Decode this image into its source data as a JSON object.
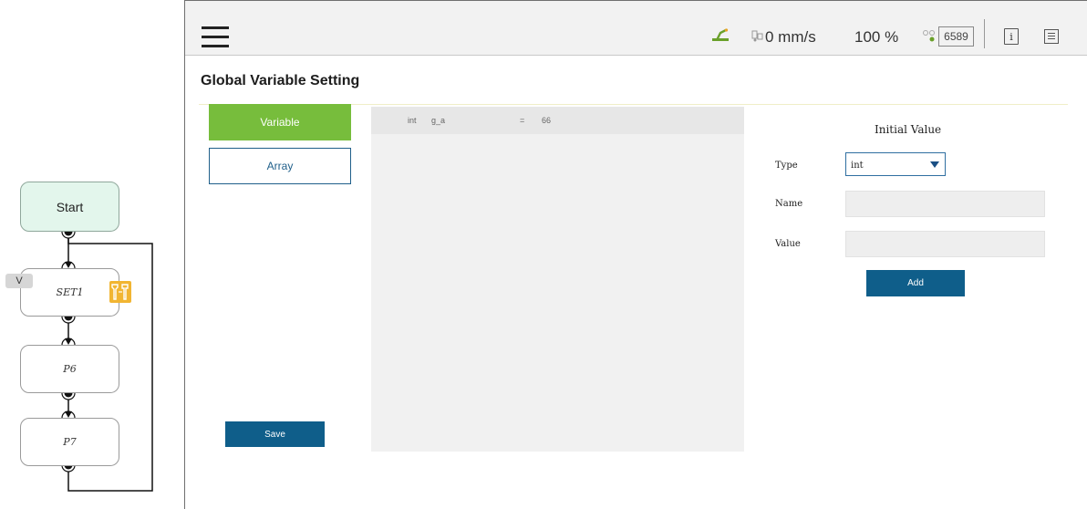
{
  "flow": {
    "nodes": [
      {
        "label": "Start"
      },
      {
        "label": "SET1"
      },
      {
        "label": "P6"
      },
      {
        "label": "P7"
      }
    ],
    "v_badge": "V"
  },
  "topbar": {
    "speed": "0 mm/s",
    "percent": "100 %",
    "counter": "6589",
    "icons": [
      "menu-icon",
      "robot-arm-icon",
      "speed-icon",
      "network-icon",
      "info-icon",
      "log-icon"
    ],
    "robot_color": "#6aa02a"
  },
  "page": {
    "title": "Global Variable Setting"
  },
  "sidebar": {
    "variable_label": "Variable",
    "array_label": "Array",
    "save_label": "Save"
  },
  "variables": [
    {
      "type": "int",
      "name": "g_a",
      "eq": "=",
      "value": "66"
    }
  ],
  "form": {
    "title": "Initial Value",
    "type_label": "Type",
    "type_value": "int",
    "name_label": "Name",
    "value_label": "Value",
    "add_label": "Add"
  },
  "colors": {
    "accent_green": "#77bd3c",
    "primary_blue": "#0f5e8a",
    "start_node": "#e3f6ec",
    "tool_badge": "#f1b532"
  }
}
